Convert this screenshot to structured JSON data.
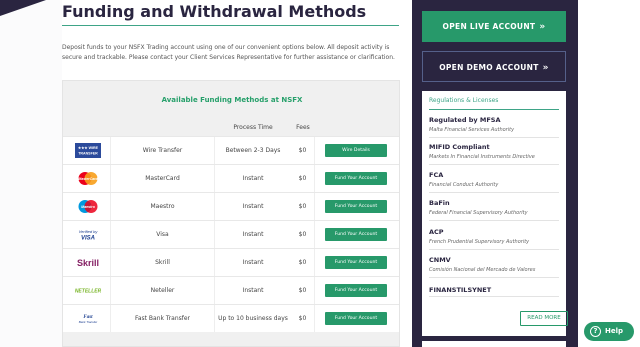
{
  "page": {
    "title": "Funding and Withdrawal Methods",
    "intro": "Deposit funds to your NSFX Trading account using one of our convenient options below. All deposit activity is secure and trackable. Please contact your Client Services Representative for further assistance or clarification."
  },
  "table": {
    "title": "Available Funding Methods at NSFX",
    "headers": {
      "process_time": "Process Time",
      "fees": "Fees"
    },
    "rows": [
      {
        "logo_icon": "wire-transfer-logo",
        "logo_text": "WIRE TRANSFER",
        "name": "Wire Transfer",
        "time": "Between 2-3 Days",
        "fee": "$0",
        "button": "Wire Details"
      },
      {
        "logo_icon": "mastercard-logo",
        "logo_text": "MasterCard",
        "name": "MasterCard",
        "time": "Instant",
        "fee": "$0",
        "button": "Fund Your Account"
      },
      {
        "logo_icon": "maestro-logo",
        "logo_text": "Maestro",
        "name": "Maestro",
        "time": "Instant",
        "fee": "$0",
        "button": "Fund Your Account"
      },
      {
        "logo_icon": "visa-logo",
        "logo_text": "Verified by VISA",
        "name": "Visa",
        "time": "Instant",
        "fee": "$0",
        "button": "Fund Your Account"
      },
      {
        "logo_icon": "skrill-logo",
        "logo_text": "Skrill",
        "name": "Skrill",
        "time": "Instant",
        "fee": "$0",
        "button": "Fund Your Account"
      },
      {
        "logo_icon": "neteller-logo",
        "logo_text": "NETELLER",
        "name": "Neteller",
        "time": "Instant",
        "fee": "$0",
        "button": "Fund Your Account"
      },
      {
        "logo_icon": "fast-bank-transfer-logo",
        "logo_text": "Fast Bank Transfer",
        "name": "Fast Bank Transfer",
        "time": "Up to 10 business days",
        "fee": "$0",
        "button": "Fund Your Account"
      }
    ]
  },
  "sidebar": {
    "live_button": "OPEN LIVE ACCOUNT",
    "demo_button": "OPEN DEMO ACCOUNT",
    "chevron": "»",
    "regulations_title": "Regulations & Licenses",
    "regulations": [
      {
        "name": "Regulated by MFSA",
        "sub": "Malta Financial Services Authority"
      },
      {
        "name": "MIFID Compliant",
        "sub": "Markets In Financial Instruments Directive"
      },
      {
        "name": "FCA",
        "sub": "Financial Conduct Authority"
      },
      {
        "name": "BaFin",
        "sub": "Federal Financial Supervisory Authority"
      },
      {
        "name": "ACP",
        "sub": "French Prudential Supervisory Authority"
      },
      {
        "name": "CNMV",
        "sub": "Comisión Nacional del Mercado de Valores"
      },
      {
        "name": "FINANSTILSYNET",
        "sub": ""
      }
    ],
    "read_more": "READ MORE"
  },
  "help": {
    "icon": "help-icon",
    "glyph": "?",
    "label": "Help"
  },
  "colors": {
    "accent": "#27996a",
    "navy": "#2a2540",
    "teal_rule": "#3ea487"
  }
}
